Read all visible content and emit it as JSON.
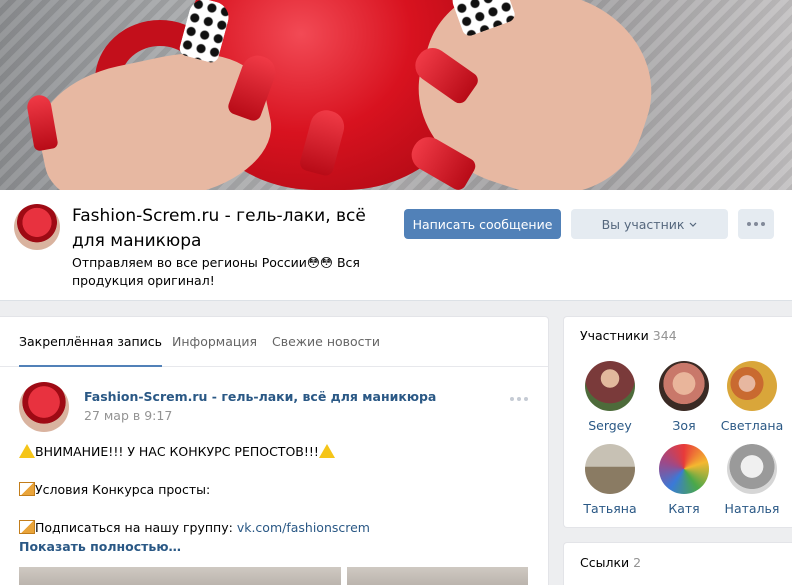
{
  "group": {
    "title": "Fashion-Screm.ru - гель-лаки, всё для маникюра",
    "status": "Отправляем во все регионы России😳😳 Вся продукция оригинал!"
  },
  "actions": {
    "message": "Написать сообщение",
    "member": "Вы участник"
  },
  "tabs": [
    "Закреплённая запись",
    "Информация",
    "Свежие новости"
  ],
  "post": {
    "author": "Fashion-Screm.ru - гель-лаки, всё для маникюра",
    "date": "27 мар в 9:17",
    "line1": "ВНИМАНИЕ!!! У НАС КОНКУРС РЕПОСТОВ!!!",
    "line2": "Условия Конкурса просты:",
    "line3_text": "Подписаться на нашу группу: ",
    "line3_link": "vk.com/fashionscrem",
    "show_more": "Показать полностью…"
  },
  "members": {
    "title": "Участники",
    "count": "344",
    "list": [
      {
        "name": "Sergey",
        "color": "#7a3a3a"
      },
      {
        "name": "Зоя",
        "color": "#c9786a"
      },
      {
        "name": "Светлана",
        "color": "#d9a63a"
      },
      {
        "name": "Татьяна",
        "color": "#8a7b63"
      },
      {
        "name": "Катя",
        "color": "#9b4a8a"
      },
      {
        "name": "Наталья",
        "color": "#9a9a9a"
      }
    ]
  },
  "links": {
    "title": "Ссылки",
    "count": "2"
  }
}
